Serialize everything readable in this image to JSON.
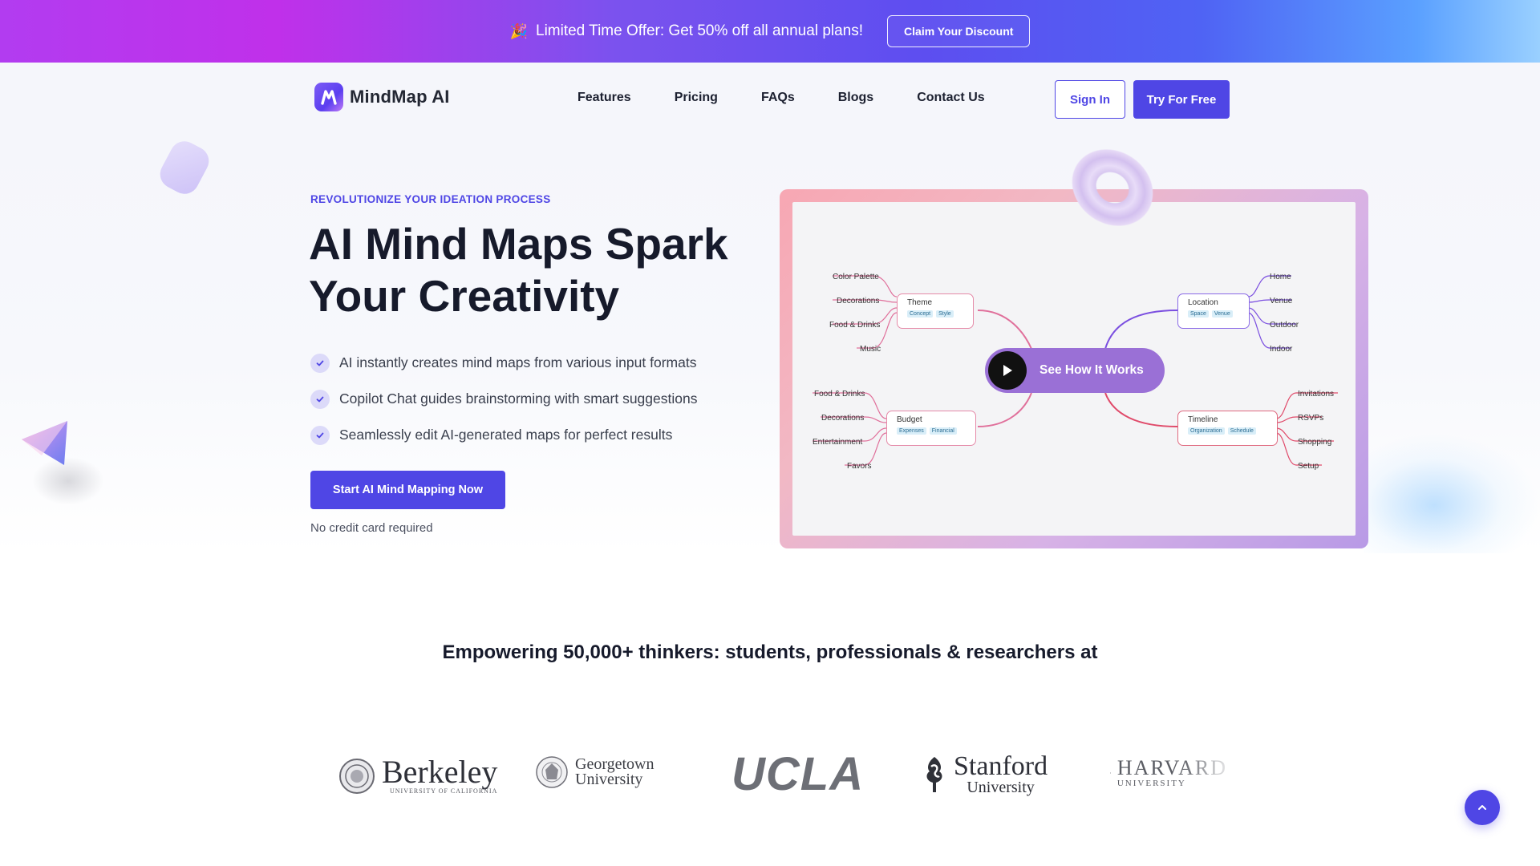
{
  "promo": {
    "emoji": "🎉",
    "text": "Limited Time Offer: Get 50% off all annual plans!",
    "button": "Claim Your Discount"
  },
  "header": {
    "logo_text": "MindMap AI",
    "nav": [
      "Features",
      "Pricing",
      "FAQs",
      "Blogs",
      "Contact Us"
    ],
    "sign_in": "Sign In",
    "try_free": "Try For Free"
  },
  "hero": {
    "eyebrow": "REVOLUTIONIZE YOUR IDEATION PROCESS",
    "title": "AI Mind Maps Spark Your Creativity",
    "features": [
      "AI instantly creates mind maps from various input formats",
      "Copilot Chat guides brainstorming with smart suggestions",
      "Seamlessly edit AI-generated maps for perfect results"
    ],
    "cta": "Start AI Mind Mapping Now",
    "note": "No credit card required"
  },
  "mindmap": {
    "play_label": "See How It Works",
    "nodes": {
      "theme": {
        "title": "Theme",
        "tags": [
          "Concept",
          "Style"
        ],
        "leaves": [
          "Color Palette",
          "Decorations",
          "Food & Drinks",
          "Music"
        ]
      },
      "budget": {
        "title": "Budget",
        "tags": [
          "Expenses",
          "Financial"
        ],
        "leaves": [
          "Food & Drinks",
          "Decorations",
          "Entertainment",
          "Favors"
        ]
      },
      "location": {
        "title": "Location",
        "tags": [
          "Space",
          "Venue"
        ],
        "leaves": [
          "Home",
          "Venue",
          "Outdoor",
          "Indoor"
        ]
      },
      "timeline": {
        "title": "Timeline",
        "tags": [
          "Organization",
          "Schedule"
        ],
        "leaves": [
          "Invitations",
          "RSVPs",
          "Shopping",
          "Setup"
        ]
      }
    }
  },
  "proof": {
    "headline": "Empowering 50,000+ thinkers: students, professionals & researchers at",
    "universities": {
      "berkeley": {
        "name": "Berkeley",
        "sub": "UNIVERSITY OF CALIFORNIA"
      },
      "georgetown": {
        "line1": "Georgetown",
        "line2": "University"
      },
      "ucla": {
        "name": "UCLA"
      },
      "stanford": {
        "line1": "Stanford",
        "line2": "University"
      },
      "harvard": {
        "line1": "HARVARD",
        "line2": "UNIVERSITY"
      }
    }
  },
  "colors": {
    "accent": "#4f46e5",
    "text_dark": "#161a2b",
    "mindmap_left_branch": "#e0709b",
    "mindmap_right_top_branch": "#7b4fe0",
    "mindmap_right_bottom_branch": "#e04a6a"
  },
  "icons": {
    "check": "check-icon",
    "play": "play-icon",
    "scroll_top": "chevron-up-icon"
  }
}
